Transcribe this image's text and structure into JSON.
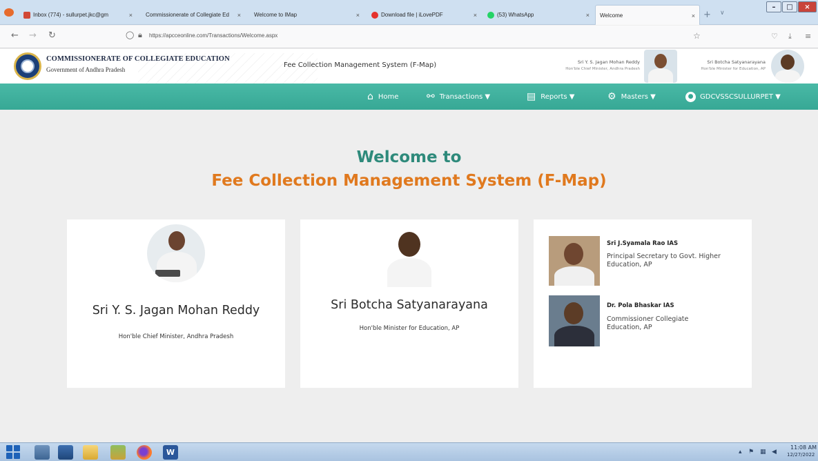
{
  "browser": {
    "tabs": [
      {
        "label": "Inbox (774) - sullurpet.jkc@gm",
        "fav_color": "#d14836"
      },
      {
        "label": "Commissionerate of Collegiate Ed",
        "fav_color": "#ffffff"
      },
      {
        "label": "Welcome to IMap",
        "fav_color": "#ffffff"
      },
      {
        "label": "Download file | iLovePDF",
        "fav_color": "#e5322d"
      },
      {
        "label": "(53) WhatsApp",
        "fav_color": "#25d366"
      },
      {
        "label": "Welcome",
        "fav_color": "#ffffff"
      }
    ],
    "url": "https://apcceonline.com/Transactions/Welcome.aspx"
  },
  "header": {
    "org_name": "COMMISSIONERATE OF COLLEGIATE EDUCATION",
    "org_sub": "Government of Andhra Pradesh",
    "system_title": "Fee Collection Management System (F-Map)",
    "person1_name": "Sri Y. S. Jagan Mohan Reddy",
    "person1_desig": "Hon'ble Chief Minister, Andhra Pradesh",
    "person2_name": "Sri Botcha Satyanarayana",
    "person2_desig": "Hon'ble Minister for Education, AP"
  },
  "nav": {
    "home": "Home",
    "transactions": "Transactions ▼",
    "reports": "Reports ▼",
    "masters": "Masters ▼",
    "user": "GDCVSSCSULLURPET ▼"
  },
  "welcome": {
    "line1": "Welcome to",
    "line2": "Fee Collection Management System (F-Map)"
  },
  "cards": {
    "cm": {
      "name": "Sri Y. S. Jagan Mohan Reddy",
      "desig": "Hon'ble Chief Minister, Andhra Pradesh"
    },
    "minister": {
      "name": "Sri Botcha Satyanarayana",
      "desig": "Hon'ble Minister for Education, AP"
    },
    "officials": [
      {
        "name": "Sri J.Syamala Rao IAS",
        "title": "Principal Secretary to Govt. Higher Education, AP"
      },
      {
        "name": "Dr. Pola Bhaskar IAS",
        "title": "Commissioner Collegiate Education, AP"
      }
    ]
  },
  "taskbar": {
    "time": "11:08 AM",
    "date": "12/27/2022"
  }
}
